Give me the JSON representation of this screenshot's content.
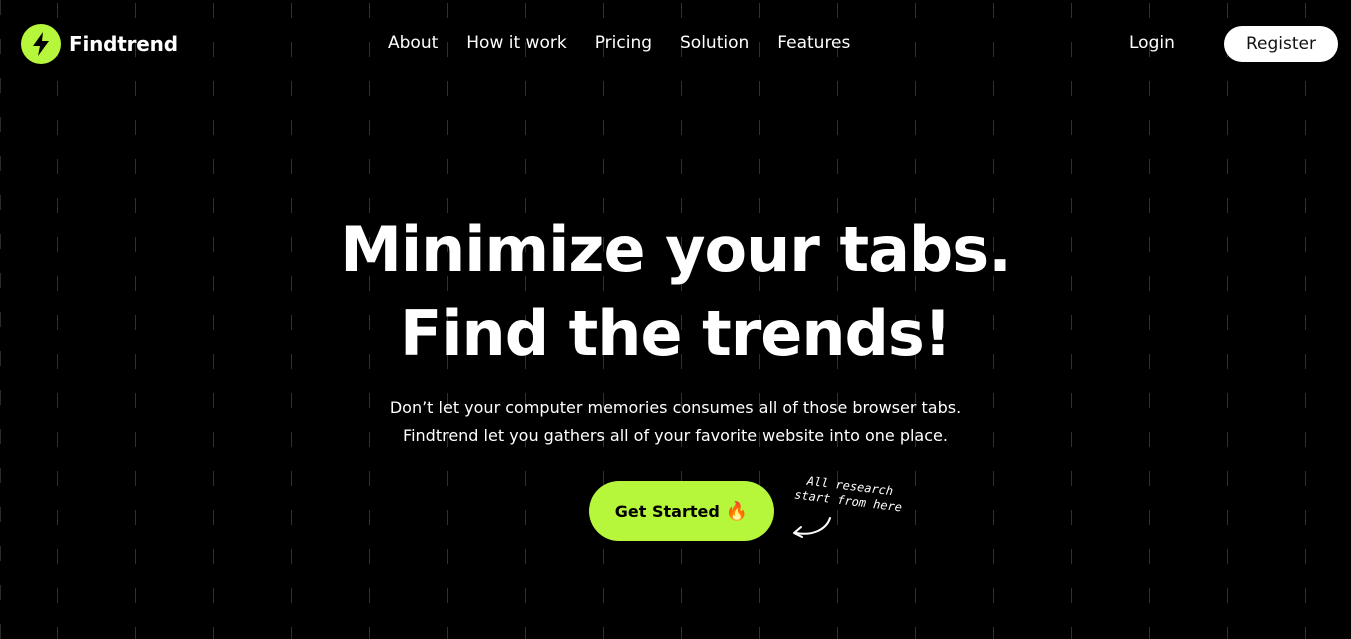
{
  "brand": {
    "name": "Findtrend",
    "accent_color": "#b6f63b",
    "logo_icon": "lightning-bolt-icon"
  },
  "nav": {
    "items": [
      {
        "label": "About"
      },
      {
        "label": "How it work"
      },
      {
        "label": "Pricing"
      },
      {
        "label": "Solution"
      },
      {
        "label": "Features"
      }
    ]
  },
  "auth": {
    "login_label": "Login",
    "register_label": "Register"
  },
  "hero": {
    "title_line1": "Minimize your tabs.",
    "title_line2": "Find the trends!",
    "subtitle_line1": "Don’t let your computer memories consumes all of those browser tabs.",
    "subtitle_line2": "Findtrend let you gathers all of your favorite website into one place.",
    "cta_label": "Get Started",
    "cta_emoji": "🔥",
    "note_line1": "All research",
    "note_line2": "start from here"
  }
}
